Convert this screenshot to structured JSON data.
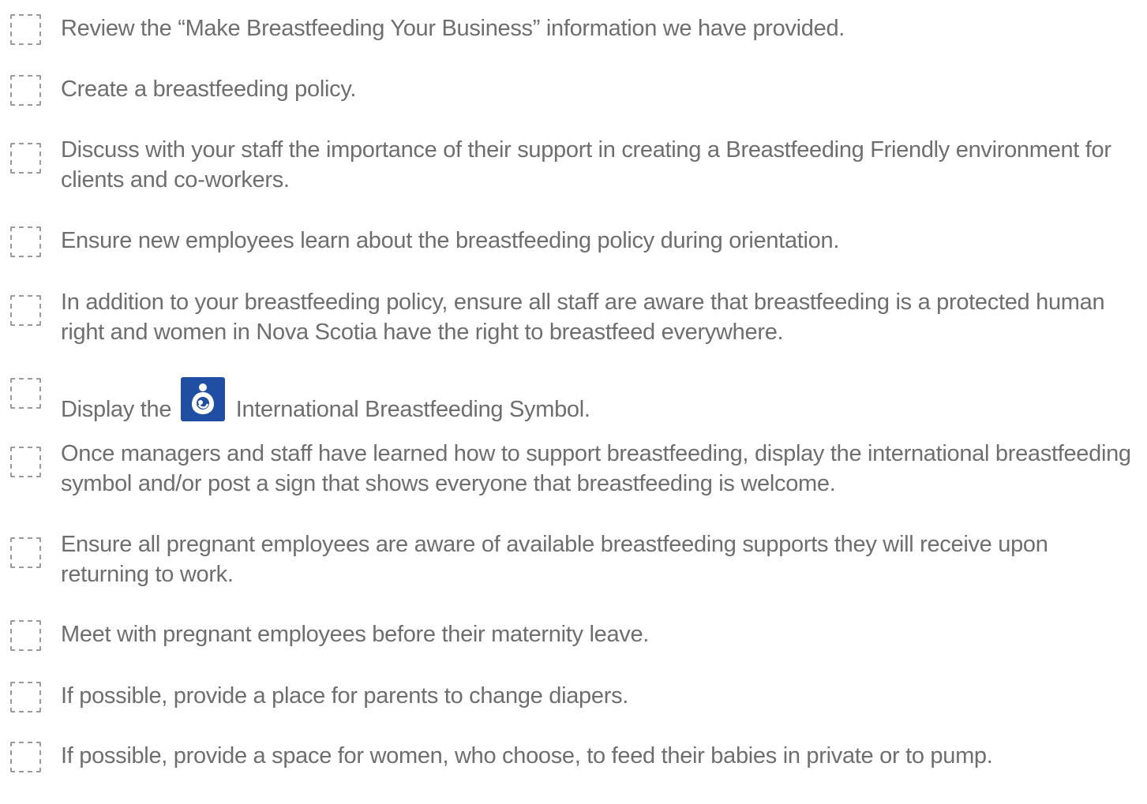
{
  "items": [
    "Review the “Make Breastfeeding Your Business” information we have provided.",
    "Create a breastfeeding policy.",
    "Discuss with your staff the importance of their support in creating a Breastfeeding Friendly environment for clients and co-workers.",
    "Ensure new employees learn about the breastfeeding policy during orientation.",
    "In addition to your breastfeeding policy, ensure all staff are aware that breastfeeding is a protected human right and women in Nova Scotia have the right to breastfeed everywhere.",
    {
      "before": "Display the",
      "after": "International Breastfeeding Symbol."
    },
    "Once managers and staff have learned how to support breastfeeding, display the international breastfeeding symbol and/or post a sign that shows everyone that breastfeeding is welcome.",
    "Ensure all pregnant employees are aware of available breastfeeding supports they will receive upon returning to work.",
    "Meet with pregnant employees before their maternity leave.",
    "If possible, provide a place for parents to change diapers.",
    "If possible, provide a space for women, who choose, to feed their babies in private or to pump."
  ],
  "icons": {
    "checkbox": "dashed-checkbox-icon",
    "breastfeeding_symbol": "international-breastfeeding-symbol-icon"
  },
  "colors": {
    "text": "#6e6e6e",
    "checkbox_border": "#9a9a9a",
    "symbol_background": "#1f4ea3"
  }
}
